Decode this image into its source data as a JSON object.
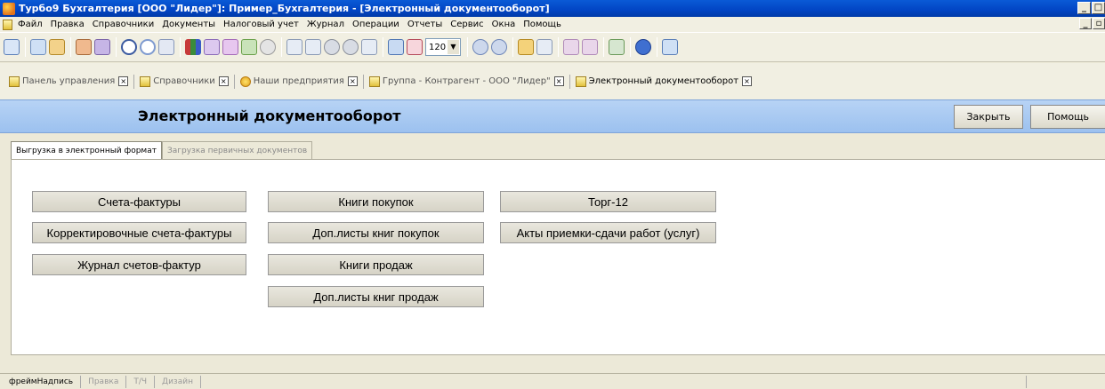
{
  "window": {
    "title": "Турбо9 Бухгалтерия [ООО \"Лидер\"]: Пример_Бухгалтерия - [Электронный документооборот]"
  },
  "menu": [
    "Файл",
    "Правка",
    "Справочники",
    "Документы",
    "Налоговый учет",
    "Журнал",
    "Операции",
    "Отчеты",
    "Сервис",
    "Окна",
    "Помощь"
  ],
  "toolbar": {
    "zoom_value": "120"
  },
  "workspace_tabs": [
    {
      "label": "Панель управления",
      "icon": "document-icon"
    },
    {
      "label": "Справочники",
      "icon": "document-icon"
    },
    {
      "label": "Наши предприятия",
      "icon": "smiley-icon"
    },
    {
      "label": "Группа - Контрагент - ООО \"Лидер\"",
      "icon": "document-icon"
    },
    {
      "label": "Электронный документооборот",
      "icon": "document-icon"
    }
  ],
  "header": {
    "title": "Электронный документооборот",
    "close_label": "Закрыть",
    "help_label": "Помощь"
  },
  "subtabs": [
    "Выгрузка в электронный формат",
    "Загрузка первичных документов"
  ],
  "buttons": {
    "col1": [
      "Счета-фактуры",
      "Корректировочные счета-фактуры",
      "Журнал счетов-фактур"
    ],
    "col2": [
      "Книги покупок",
      "Доп.листы книг покупок",
      "Книги продаж",
      "Доп.листы книг продаж"
    ],
    "col3": [
      "Торг-12",
      "Акты приемки-сдачи работ (услуг)"
    ]
  },
  "statusbar": [
    "фреймНадпись",
    "Правка",
    "Т/Ч",
    "Дизайн"
  ],
  "colors": {
    "title_bar": "#0245c4",
    "header_band": "#9cc1ef"
  }
}
